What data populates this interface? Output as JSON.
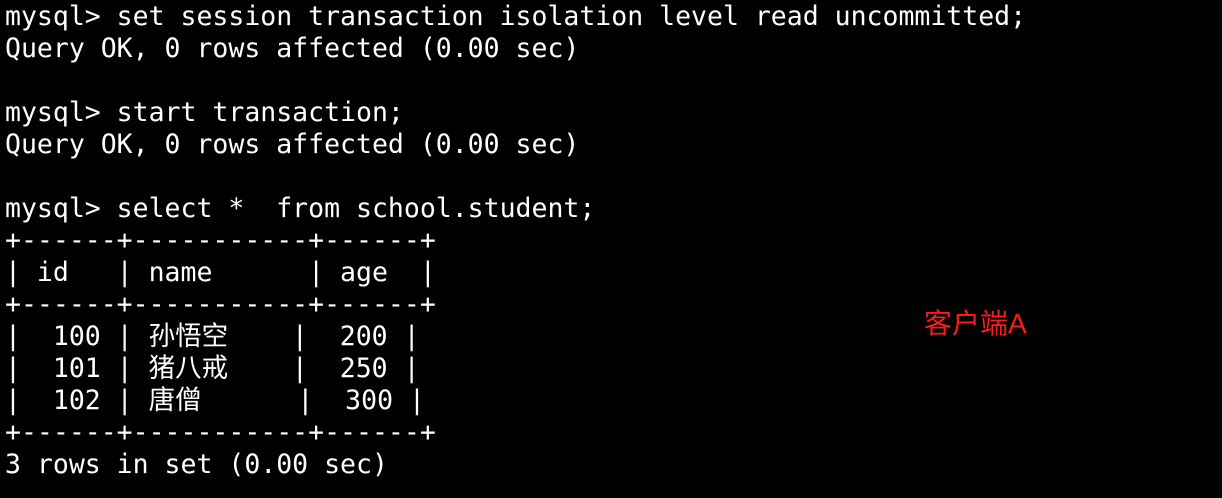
{
  "terminal": {
    "lines": [
      "mysql> set session transaction isolation level read uncommitted;",
      "Query OK, 0 rows affected (0.00 sec)",
      "",
      "mysql> start transaction;",
      "Query OK, 0 rows affected (0.00 sec)",
      "",
      "mysql> select *  from school.student;",
      "+------+-----------+------+",
      "| id   | name      | age  |",
      "+------+-----------+------+",
      "|  100 | 孙悟空    |  200 |",
      "|  101 | 猪八戒    |  250 |",
      "|  102 | 唐僧      |  300 |",
      "+------+-----------+------+",
      "3 rows in set (0.00 sec)"
    ],
    "text_color": "#ffffff",
    "background": "#000000"
  },
  "annotation": {
    "text": "客户端A",
    "color": "#ff1a1a"
  }
}
